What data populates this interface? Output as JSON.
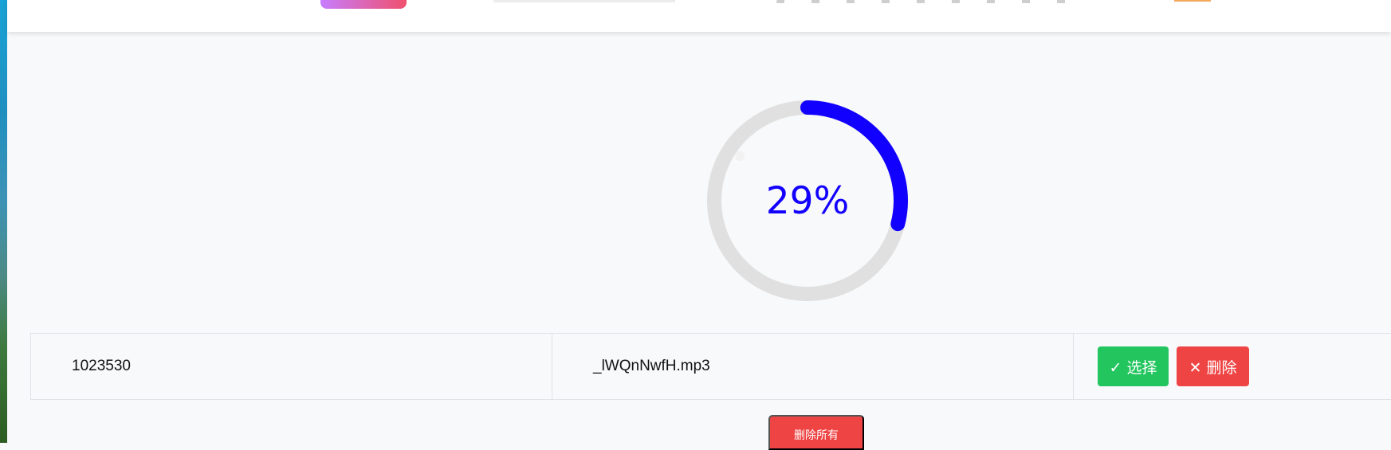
{
  "progress": {
    "percent": 29,
    "label": "29%",
    "ring_colors": {
      "track": "#e0e0e0",
      "start": "#ff00ff",
      "end": "#1200ff"
    }
  },
  "file_row": {
    "id": "1023530",
    "file_name": "_lWQnNwfH.mp3",
    "select_label": "✓ 选择",
    "delete_label": "✕ 删除"
  },
  "delete_all_label": "删除所有",
  "colors": {
    "page_bg": "#f8f9fa",
    "select_button": "#22c55e",
    "delete_button": "#ef4444"
  }
}
